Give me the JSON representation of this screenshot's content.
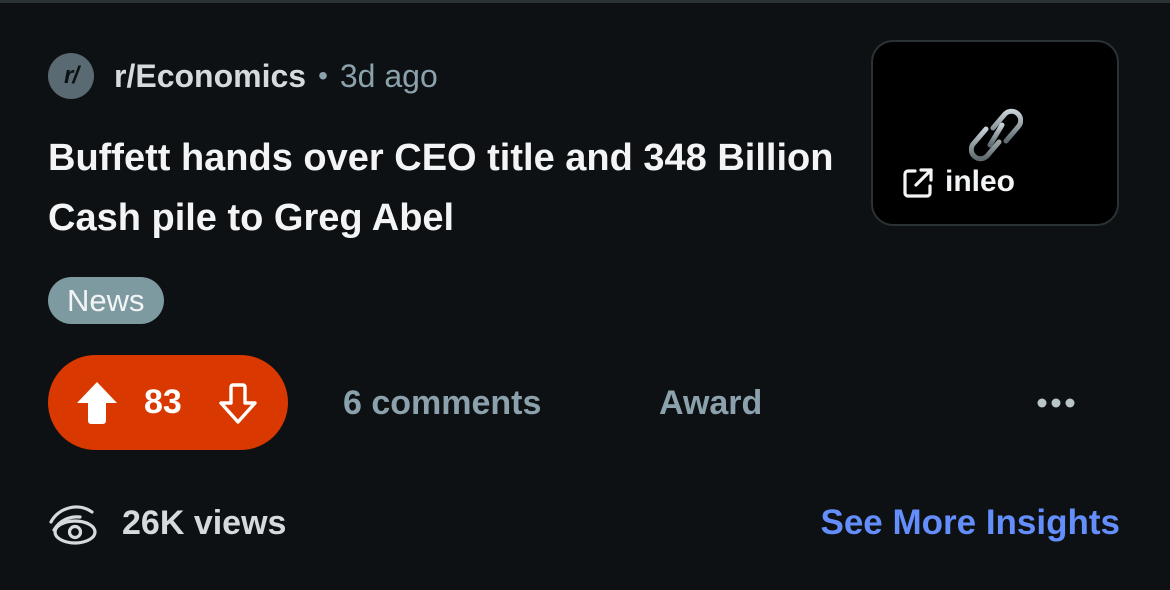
{
  "post": {
    "subreddit": {
      "avatar_text": "r/",
      "name": "r/Economics",
      "separator": "•",
      "time": "3d ago"
    },
    "title": "Buffett hands over CEO title and 348 Billion Cash pile to Greg Abel",
    "thumbnail": {
      "link_icon": "chain-link-icon",
      "external_icon": "external-link-icon",
      "domain": "inleo",
      "background": "#000000"
    },
    "flair": {
      "label": "News",
      "color": "#7e9aa1"
    },
    "votes": {
      "score": "83",
      "upvoted": true,
      "pill_color": "#d93900",
      "up_icon": "upvote-arrow-icon",
      "down_icon": "downvote-arrow-icon"
    },
    "actions": {
      "comments_label": "6 comments",
      "award_label": "Award",
      "more_icon": "more-options-icon"
    },
    "footer": {
      "views_icon": "views-eye-icon",
      "views_label": "26K views",
      "insights_label": "See More Insights",
      "insights_color": "#648efc"
    }
  }
}
